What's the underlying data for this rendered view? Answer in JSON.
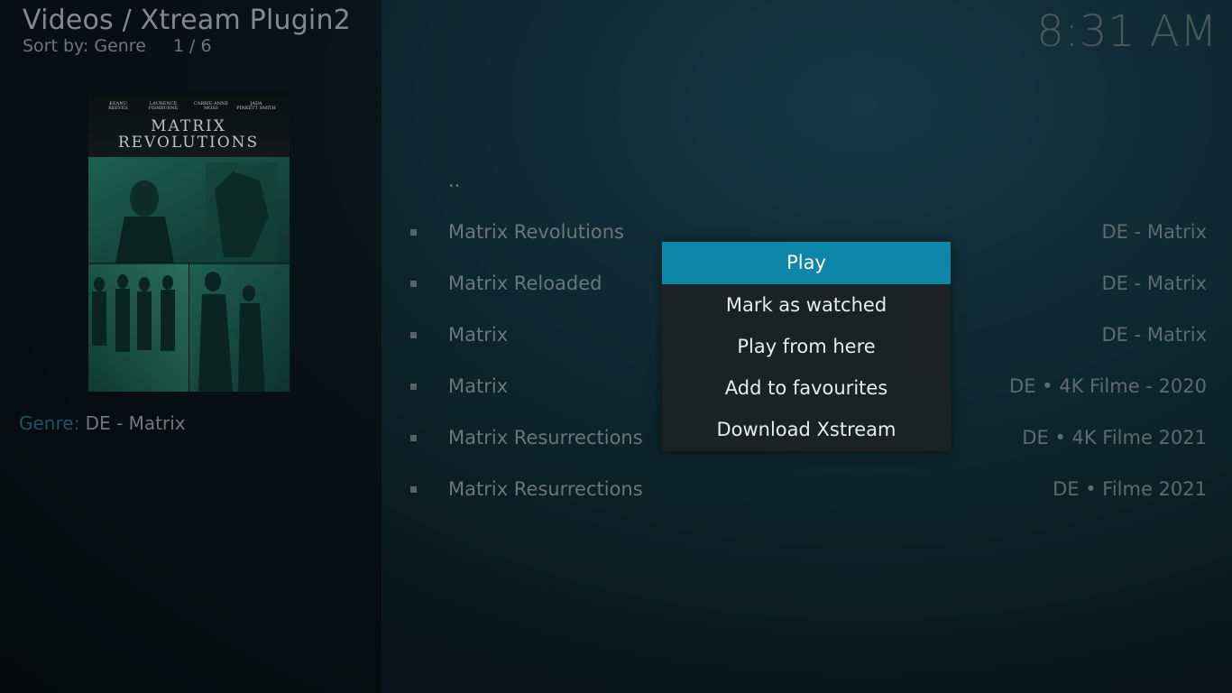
{
  "header": {
    "title": "Videos / Xtream Plugin2",
    "sort_label": "Sort by: Genre",
    "sort_icon": "",
    "position": "1 / 6"
  },
  "clock": "8:31 AM",
  "poster": {
    "actors": [
      "KEANU REEVES",
      "LAURENCE FISHBURNE",
      "CARRIE-ANNE MOSS",
      "JADA PINKETT SMITH"
    ],
    "title_line1": "MATRIX",
    "title_line2": "REVOLUTIONS"
  },
  "details": {
    "genre_label": "Genre: ",
    "genre_value": "DE - Matrix"
  },
  "list": {
    "parent_label": "..",
    "items": [
      {
        "title": "Matrix Revolutions",
        "info": "DE - Matrix"
      },
      {
        "title": "Matrix Reloaded",
        "info": "DE - Matrix"
      },
      {
        "title": "Matrix",
        "info": "DE - Matrix"
      },
      {
        "title": "Matrix",
        "info": "DE • 4K Filme  - 2020"
      },
      {
        "title": "Matrix Resurrections",
        "info": "DE • 4K Filme 2021"
      },
      {
        "title": "Matrix Resurrections",
        "info": "DE • Filme 2021"
      }
    ]
  },
  "context_menu": {
    "items": [
      "Play",
      "Mark as watched",
      "Play from here",
      "Add to favourites",
      "Download Xstream"
    ],
    "active_index": 0
  },
  "colors": {
    "accent": "#0e86a7",
    "menu_bg": "#1c2224",
    "genre_label": "#1d5566"
  }
}
